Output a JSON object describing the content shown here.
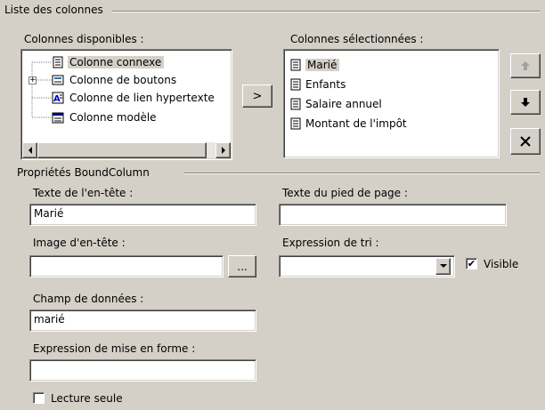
{
  "columns_group": {
    "title": "Liste des colonnes",
    "available_label": "Colonnes disponibles :",
    "selected_label": "Colonnes sélectionnées :",
    "available": [
      {
        "label": "Colonne connexe",
        "icon": "bound-column-icon"
      },
      {
        "label": "Colonne de boutons",
        "icon": "button-column-icon"
      },
      {
        "label": "Colonne de lien hypertexte",
        "icon": "hyperlink-column-icon"
      },
      {
        "label": "Colonne modèle",
        "icon": "template-column-icon"
      }
    ],
    "selected": [
      "Marié",
      "Enfants",
      "Salaire annuel",
      "Montant de l'impôt"
    ],
    "add_button": ">",
    "move_up_icon": "arrow-up-icon",
    "move_down_icon": "arrow-down-icon",
    "delete_icon": "delete-x-icon"
  },
  "properties_group": {
    "title": "Propriétés BoundColumn",
    "header_text_label": "Texte de l'en-tête :",
    "header_text_value": "Marié",
    "footer_text_label": "Texte du pied de page :",
    "footer_text_value": "",
    "header_image_label": "Image d'en-tête :",
    "header_image_value": "",
    "browse_button": "...",
    "sort_expression_label": "Expression de tri :",
    "sort_expression_value": "",
    "visible_label": "Visible",
    "visible_checked": true,
    "data_field_label": "Champ de données :",
    "data_field_value": "marié",
    "format_expression_label": "Expression de mise en forme :",
    "format_expression_value": "",
    "read_only_label": "Lecture seule",
    "read_only_checked": false
  }
}
